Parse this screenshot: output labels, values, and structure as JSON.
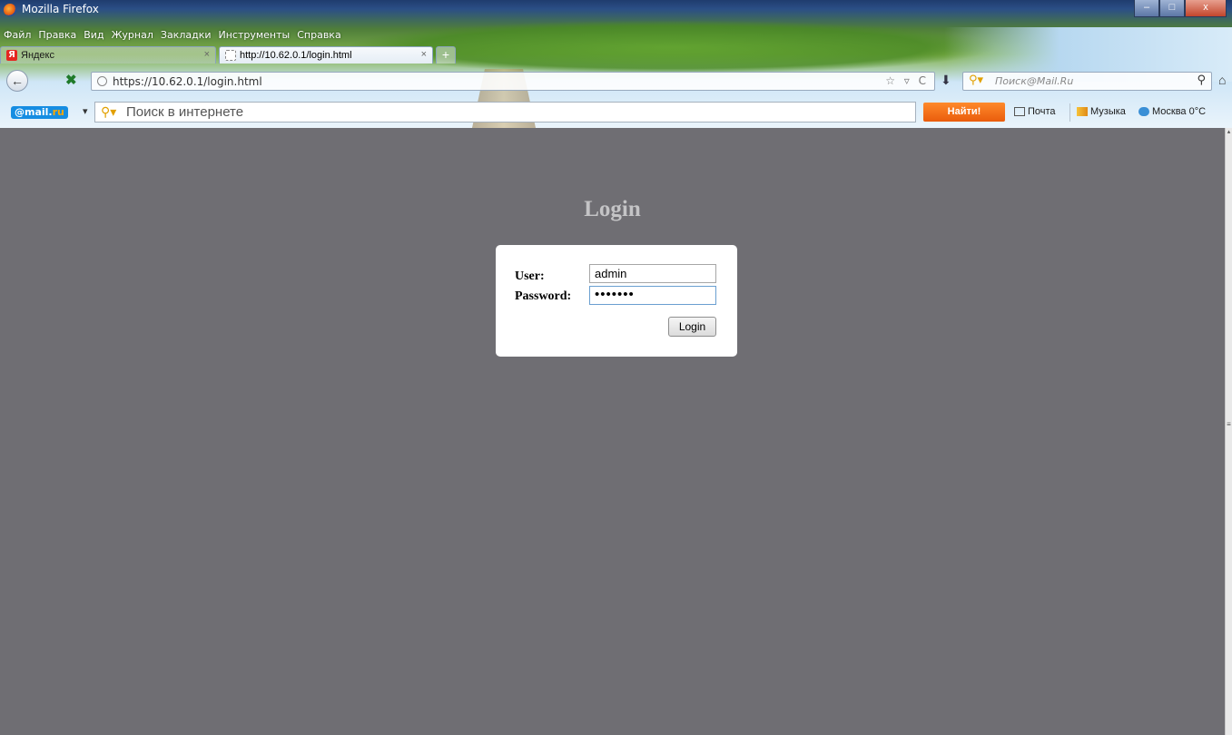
{
  "window": {
    "title": "Mozilla Firefox",
    "controls": {
      "minimize": "–",
      "maximize": "□",
      "close": "x"
    }
  },
  "menu": [
    "Файл",
    "Правка",
    "Вид",
    "Журнал",
    "Закладки",
    "Инструменты",
    "Справка"
  ],
  "tabs": [
    {
      "label": "Яндекс",
      "icon": "yandex-icon",
      "close": "×"
    },
    {
      "label": "http://10.62.0.1/login.html",
      "icon": "page-icon",
      "close": "×"
    }
  ],
  "new_tab": "+",
  "navigation": {
    "back": "←",
    "url": "https://10.62.0.1/login.html",
    "url_icons": "☆ ▿ C",
    "search_placeholder": "Поиск@Mail.Ru",
    "download": "⬇",
    "home": "⌂"
  },
  "mailru_toolbar": {
    "logo_at": "@mail.",
    "logo_ru": "ru",
    "dropdown": "▾",
    "search_placeholder": "Поиск в интернете",
    "find_button": "Найти!",
    "mail_link": "Почта",
    "music_link": "Музыка",
    "weather_link": "Москва 0°C"
  },
  "login": {
    "heading": "Login",
    "user_label": "User:",
    "user_value": "admin",
    "password_label": "Password:",
    "password_value": "•••••••",
    "button": "Login"
  },
  "colors": {
    "page_background": "#6f6e73",
    "heading": "#c4c4c6",
    "find_button": "#f07020",
    "mailru_logo": "#168de2"
  }
}
